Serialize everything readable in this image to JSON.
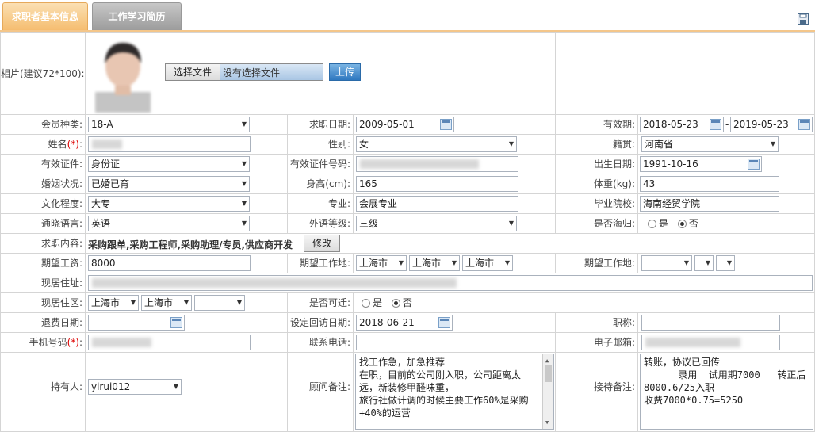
{
  "tabs": [
    {
      "label": "求职者基本信息"
    },
    {
      "label": "工作学习简历"
    }
  ],
  "photo": {
    "label": "相片(建议72*100):",
    "file_button": "选择文件",
    "file_status": "没有选择文件",
    "upload_button": "上传"
  },
  "row1": {
    "member_type_label": "会员种类:",
    "member_type": "18-A",
    "apply_date_label": "求职日期:",
    "apply_date": "2009-05-01",
    "valid_label": "有效期:",
    "valid_from": "2018-05-23",
    "valid_sep": "-",
    "valid_to": "2019-05-23"
  },
  "row2": {
    "name_label": "姓名",
    "req": "(*)",
    "colon": ":",
    "gender_label": "性别:",
    "gender": "女",
    "native_label": "籍贯:",
    "native": "河南省"
  },
  "row3": {
    "id_type_label": "有效证件:",
    "id_type": "身份证",
    "id_no_label": "有效证件号码:",
    "birth_label": "出生日期:",
    "birth": "1991-10-16"
  },
  "row4": {
    "marital_label": "婚姻状况:",
    "marital": "已婚已育",
    "height_label": "身高(cm):",
    "height": "165",
    "weight_label": "体重(kg):",
    "weight": "43"
  },
  "row5": {
    "edu_label": "文化程度:",
    "edu": "大专",
    "major_label": "专业:",
    "major": "会展专业",
    "school_label": "毕业院校:",
    "school": "海南经贸学院"
  },
  "row6": {
    "lang_label": "通晓语言:",
    "lang": "英语",
    "lang_level_label": "外语等级:",
    "lang_level": "三级",
    "overseas_label": "是否海归:",
    "yes": "是",
    "no": "否"
  },
  "row7": {
    "job_label": "求职内容:",
    "job": "采购跟单,采购工程师,采购助理/专员,供应商开发",
    "edit_button": "修改"
  },
  "row8": {
    "salary_label": "期望工资:",
    "salary": "8000",
    "work_place_label": "期望工作地:",
    "wp1": "上海市",
    "wp2": "上海市",
    "wp3": "上海市",
    "work_place2_label": "期望工作地:"
  },
  "row9": {
    "address_label": "现居住址:"
  },
  "row10": {
    "district_label": "现居住区:",
    "d1": "上海市",
    "d2": "上海市",
    "relocate_label": "是否可迁:",
    "yes": "是",
    "no": "否"
  },
  "row11": {
    "refund_label": "退费日期:",
    "revisit_label": "设定回访日期:",
    "revisit": "2018-06-21",
    "title_label": "职称:"
  },
  "row12": {
    "mobile_label": "手机号码",
    "req": "(*)",
    "colon": ":",
    "phone_label": "联系电话:",
    "email_label": "电子邮箱:"
  },
  "row13": {
    "holder_label": "持有人:",
    "holder": "yirui012",
    "advisor_note_label": "顾问备注:",
    "advisor_note": "找工作急，加急推荐\n在职，目前的公司刚入职，公司距离太远，新装修甲醛味重，\n旅行社做计调的时候主要工作60%是采购+40%的运营",
    "reception_note_label": "接待备注:",
    "reception_note": "转账，协议已回传\n      录用  试用期7000   转正后8000.6/25入职\n收费7000*0.75=5250"
  }
}
